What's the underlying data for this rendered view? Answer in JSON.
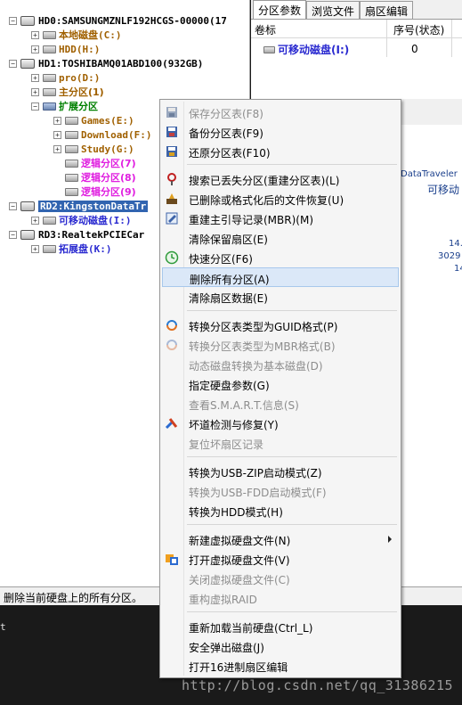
{
  "tree": {
    "hd0": {
      "label": "HD0:SAMSUNGMZNLF192HCGS-00000(17",
      "expander": "−"
    },
    "hd0_c": {
      "label": "本地磁盘(C:)",
      "expander": "+"
    },
    "hd0_h": {
      "label": "HDD(H:)",
      "expander": "+"
    },
    "hd1": {
      "label": "HD1:TOSHIBAMQ01ABD100(932GB)",
      "expander": "−"
    },
    "hd1_d": {
      "label": "pro(D:)",
      "expander": "+"
    },
    "hd1_primary": {
      "label": "主分区(1)",
      "expander": "+"
    },
    "hd1_extended": {
      "label": "扩展分区",
      "expander": "−"
    },
    "hd1_games": {
      "label": "Games(E:)",
      "expander": "+"
    },
    "hd1_download": {
      "label": "Download(F:)",
      "expander": "+"
    },
    "hd1_study": {
      "label": "Study(G:)",
      "expander": "+"
    },
    "hd1_log7": {
      "label": "逻辑分区(7)"
    },
    "hd1_log8": {
      "label": "逻辑分区(8)"
    },
    "hd1_log9": {
      "label": "逻辑分区(9)"
    },
    "rd2": {
      "label": "RD2:KingstonDataTr",
      "expander": "−"
    },
    "rd2_i": {
      "label": "可移动磁盘(I:)",
      "expander": "+"
    },
    "rd3": {
      "label": "RD3:RealtekPCIECar",
      "expander": "−"
    },
    "rd3_k": {
      "label": "拓展盘(K:)",
      "expander": "+"
    }
  },
  "tabs": [
    "分区参数",
    "浏览文件",
    "扇区编辑"
  ],
  "grid": {
    "col_label": "卷标",
    "col_index": "序号(状态)",
    "row_label": "可移动磁盘(I:)",
    "row_index": "0"
  },
  "details": {
    "line1": "DataTraveler",
    "line2": "可移动",
    "line3": "14.",
    "line4": "3029",
    "line5": "14"
  },
  "menu": {
    "save_table": "保存分区表(F8)",
    "backup_table": "备份分区表(F9)",
    "restore_table": "还原分区表(F10)",
    "search_lost": "搜索已丢失分区(重建分区表)(L)",
    "recover_files": "已删除或格式化后的文件恢复(U)",
    "rebuild_mbr": "重建主引导记录(MBR)(M)",
    "clear_reserved": "清除保留扇区(E)",
    "quick_partition": "快速分区(F6)",
    "delete_all": "删除所有分区(A)",
    "clear_sectors": "清除扇区数据(E)",
    "to_guid": "转换分区表类型为GUID格式(P)",
    "to_mbr": "转换分区表类型为MBR格式(B)",
    "dynamic_to_basic": "动态磁盘转换为基本磁盘(D)",
    "disk_params": "指定硬盘参数(G)",
    "smart_info": "查看S.M.A.R.T.信息(S)",
    "bad_track": "坏道检测与修复(Y)",
    "reset_bad": "复位坏扇区记录",
    "usb_zip": "转换为USB-ZIP启动模式(Z)",
    "usb_fdd": "转换为USB-FDD启动模式(F)",
    "hdd_mode": "转换为HDD模式(H)",
    "new_vdisk": "新建虚拟硬盘文件(N)",
    "open_vdisk": "打开虚拟硬盘文件(V)",
    "close_vdisk": "关闭虚拟硬盘文件(C)",
    "reassemble_raid": "重构虚拟RAID",
    "reload_disk": "重新加载当前硬盘(Ctrl_L)",
    "eject_disk": "安全弹出磁盘(J)",
    "open_hex": "打开16进制扇区编辑"
  },
  "status": {
    "text": "删除当前硬盘上的所有分区。"
  },
  "console": {
    "text": "t"
  },
  "watermark": "http://blog.csdn.net/qq_31386215"
}
